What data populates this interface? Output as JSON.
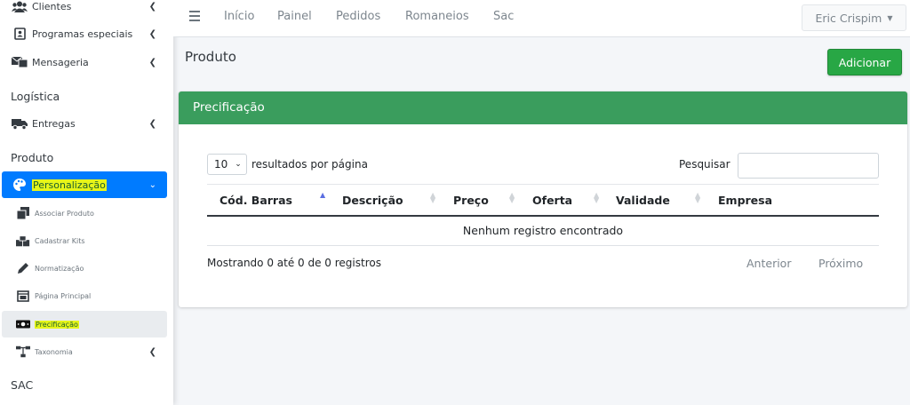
{
  "sidebar": {
    "items": [
      {
        "label": "Clientes",
        "icon": "users-icon"
      },
      {
        "label": "Programas especiais",
        "icon": "id-card-icon"
      },
      {
        "label": "Mensageria",
        "icon": "messaging-icon"
      }
    ],
    "section_logistica": "Logística",
    "entregas": {
      "label": "Entregas",
      "icon": "truck-icon"
    },
    "section_produto": "Produto",
    "personalizacao": {
      "label": "Personalização",
      "icon": "palette-icon"
    },
    "subitems": [
      {
        "label": "Associar Produto",
        "icon": "clone-icon"
      },
      {
        "label": "Cadastrar Kits",
        "icon": "boxes-icon"
      },
      {
        "label": "Normatização",
        "icon": "pen-icon"
      },
      {
        "label": "Página Principal",
        "icon": "window-icon"
      },
      {
        "label": "Precificação",
        "icon": "money-icon"
      },
      {
        "label": "Taxonomia",
        "icon": "sitemap-icon"
      }
    ],
    "section_sac": "SAC"
  },
  "topbar": {
    "nav": [
      "Início",
      "Painel",
      "Pedidos",
      "Romaneios",
      "Sac"
    ],
    "user": "Eric Crispim"
  },
  "page": {
    "title": "Produto",
    "add_button": "Adicionar"
  },
  "card": {
    "title": "Precificação",
    "length_value": "10",
    "length_label": "resultados por página",
    "search_label": "Pesquisar",
    "search_value": "",
    "columns": [
      "Cód. Barras",
      "Descrição",
      "Preço",
      "Oferta",
      "Validade",
      "Empresa"
    ],
    "empty_message": "Nenhum registro encontrado",
    "info": "Mostrando 0 até 0 de 0 registros",
    "prev": "Anterior",
    "next": "Próximo"
  },
  "colors": {
    "sidebar_active": "#007bff",
    "card_header": "#3a9d5d",
    "add_button": "#28a745",
    "highlight": "#e6f51a"
  }
}
